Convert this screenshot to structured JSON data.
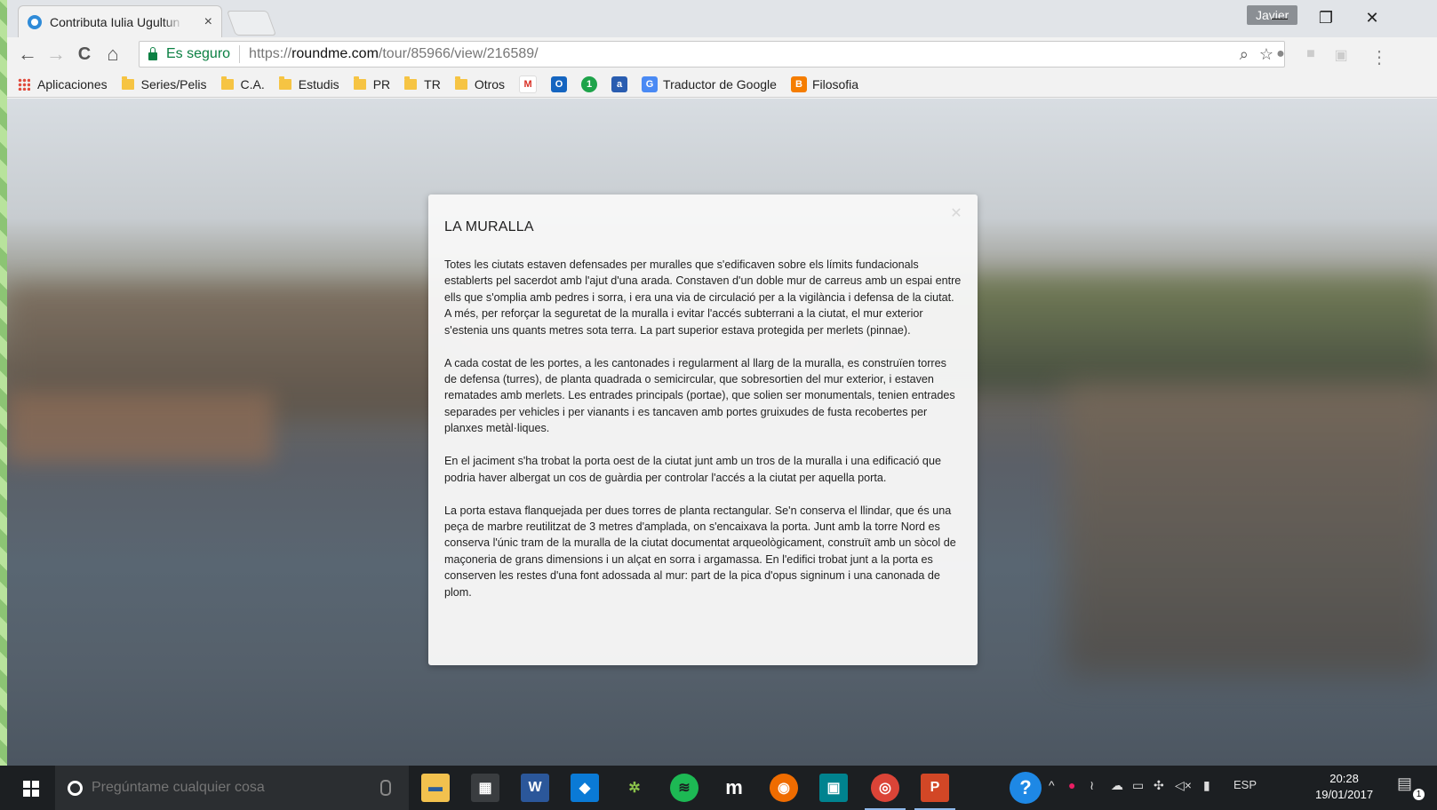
{
  "browser": {
    "tab_title": "Contributa Iulia Ugultun",
    "tab_close": "×",
    "profile_name": "Javier",
    "window_controls": {
      "minimize": "—",
      "restore": "❐",
      "close": "✕"
    }
  },
  "toolbar": {
    "back": "←",
    "forward": "→",
    "reload": "C",
    "home": "⌂",
    "secure_label": "Es seguro",
    "url_scheme": "https://",
    "url_host": "roundme.com",
    "url_path": "/tour/85966/view/216589/",
    "zoom_icon": "⌕",
    "star_icon": "☆",
    "menu_icon": "⋮"
  },
  "bookmarks": {
    "apps_label": "Aplicaciones",
    "folders": [
      "Series/Pelis",
      "C.A.",
      "Estudis",
      "PR",
      "TR",
      "Otros"
    ],
    "translate_label": "Traductor de Google",
    "filosofia_label": "Filosofia"
  },
  "modal": {
    "title": "LA MURALLA",
    "paragraphs": [
      "Totes les ciutats estaven defensades per muralles que s'edificaven sobre els límits fundacionals establerts pel sacerdot amb l'ajut d'una arada. Constaven d'un doble mur de carreus amb un espai entre ells que s'omplia amb pedres i sorra, i era una via de circulació per a la vigilància i defensa de la ciutat. A més, per reforçar la seguretat de la muralla i evitar l'accés subterrani a la ciutat, el mur exterior s'estenia uns quants metres sota terra. La part superior estava protegida per merlets (pinnae).",
      "A cada costat de les portes, a les cantonades i regularment al llarg de la muralla, es construïen torres de defensa (turres), de planta quadrada o semicircular, que sobresortien del mur exterior, i estaven rematades amb merlets. Les entrades principals (portae), que solien ser monumentals, tenien entrades separades per vehicles i per vianants i es tancaven amb portes gruixudes de fusta recobertes per planxes metàl·liques.",
      "En el jaciment s'ha trobat la porta oest de la ciutat junt amb un tros de la muralla i una edificació que podria haver albergat un cos de guàrdia per controlar l'accés a la ciutat per aquella porta.",
      "La porta estava flanquejada per dues torres de planta rectangular. Se'n conserva el llindar, que és una peça de marbre reutilitzat de 3 metres d'amplada, on s'encaixava la porta. Junt amb la torre Nord es conserva l'únic tram de la muralla de la ciutat documentat arqueològicament, construït amb un sòcol de maçoneria de grans dimensions i un alçat en sorra i argamassa. En l'edifici trobat junt a la porta es conserven les restes d'una font adossada al mur: part de la pica d'opus signinum i una canonada de plom."
    ]
  },
  "taskbar": {
    "search_placeholder": "Pregúntame cualquier cosa",
    "language": "ESP",
    "time": "20:28",
    "date": "19/01/2017",
    "notification_count": "1"
  }
}
